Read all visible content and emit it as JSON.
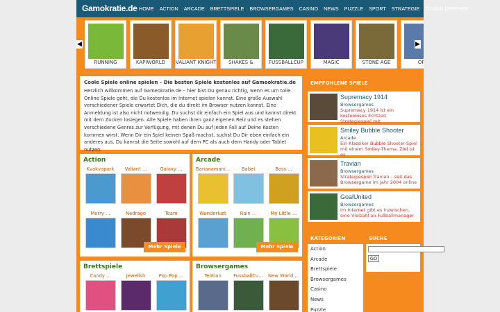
{
  "header": {
    "logo": "Gamokratie.de",
    "nav": [
      "HOME",
      "ACTION",
      "ARCADE",
      "BRETTSPIELE",
      "BROWSERGAMES",
      "CASINO",
      "NEWS",
      "PUZZLE",
      "SPORT",
      "STRATEGIE",
      "TOWER DEFENSE"
    ]
  },
  "slider": {
    "items": [
      {
        "label": "RUNNING",
        "color": "#7ab83a"
      },
      {
        "label": "KAPIWORLD",
        "color": "#8a5a2a"
      },
      {
        "label": "VALIANT KNIGHT",
        "color": "#e8a030"
      },
      {
        "label": "SHAKES &",
        "color": "#6a8a4a"
      },
      {
        "label": "FUSSBALLCUP",
        "color": "#3a6a3a"
      },
      {
        "label": "MAGIC",
        "color": "#4a3a7a"
      },
      {
        "label": "STONE AGE",
        "color": "#7a6a3a"
      },
      {
        "label": "OR",
        "color": "#5a7aaa"
      }
    ]
  },
  "intro": {
    "title": "Coole Spiele online spielen – Die besten Spiele kostenlos auf Gameokratie.de",
    "text": "Herzlich willkommen auf Gameokratie.de – hier bist Du genau richtig, wenn es um tolle Online Spiele geht, die Du kostenlos im Internet spielen kannst. Eine große Auswahl verschiedener Spiele erwartet Dich, die du direkt im Browser nutzen kannst. Eine Anmeldung ist also nicht notwendig. Du suchst dir einfach ein Spiel aus und kannst direkt mit dem Zocken loslegen. Alle Spiele haben ihren ganz eigenen Reiz und es stehen verschiedene Genres zur Verfügung, mit denen Du auf jeden Fall auf Deine Kosten kommen wirst. Wenn Dir ein Spiel keinen Spaß machst, suchst Du Dir eben einfach ein anderes aus. Du kannst die Seite sowohl auf dem PC als auch dem Handy oder Tablet nutzen."
  },
  "sections": [
    {
      "title": "Action",
      "more": "Mehr Spiele",
      "games": [
        {
          "label": "Kvakvapark",
          "color": "#4a9ad0"
        },
        {
          "label": "Valiant ...",
          "color": "#e89040"
        },
        {
          "label": "Galaxy ...",
          "color": "#c04040"
        },
        {
          "label": "Merry ...",
          "color": "#3a8ad0"
        },
        {
          "label": "Nedrago",
          "color": "#7a4a2a"
        },
        {
          "label": "Team",
          "color": "#aa3a3a"
        }
      ]
    },
    {
      "title": "Arcade",
      "more": "Mehr Spiele",
      "games": [
        {
          "label": "Bananamani...",
          "color": "#e8c030"
        },
        {
          "label": "Babel",
          "color": "#80c0e0"
        },
        {
          "label": "Boss ...",
          "color": "#d0a020"
        },
        {
          "label": "Wanderlust",
          "color": "#5aa0d0"
        },
        {
          "label": "Rain ...",
          "color": "#70b050"
        },
        {
          "label": "My Little ...",
          "color": "#8ac040"
        }
      ]
    },
    {
      "title": "Brettspiele",
      "games": [
        {
          "label": "Candy ...",
          "color": "#e05080"
        },
        {
          "label": "Jewelish",
          "color": "#5a2a6a"
        },
        {
          "label": "Pop Pop ...",
          "color": "#40a0d0"
        }
      ]
    },
    {
      "title": "Browsergames",
      "games": [
        {
          "label": "Tentlan",
          "color": "#5a6a8a"
        },
        {
          "label": "FussballCu...",
          "color": "#3a5a3a"
        },
        {
          "label": "New World ...",
          "color": "#6a4a2a"
        }
      ]
    }
  ],
  "featured": {
    "title": "EMPFOHLENE SPIELE",
    "items": [
      {
        "name": "Supremacy 1914",
        "category": "Browsergames",
        "desc": "Supremacy 1914 ist ein kostenloses Echtzeit Strategiespiel mit",
        "color": "#5a4a3a"
      },
      {
        "name": "Smiley Bubble Shooter",
        "category": "Arcade",
        "desc": "Ein Klassiker Bubble Shooter-Spiel mit einem Smiley-Thema, Ziel ist es",
        "color": "#e8c020"
      },
      {
        "name": "Travian",
        "category": "Browsergames",
        "desc": "Strategiespiel Travian – seit das Browsergame im Jahr 2004 online",
        "color": "#8a6a4a"
      },
      {
        "name": "GoalUnited",
        "category": "Browsergames",
        "desc": "Im Internet gibt es inzwischen, eine Vielzahl an Fußballmanager",
        "color": "#3a6a3a"
      }
    ]
  },
  "categories": {
    "title": "KATEGORIEN",
    "items": [
      "Action",
      "Arcade",
      "Brettspiele",
      "Browsergames",
      "Casino",
      "News",
      "Puzzle"
    ]
  },
  "search": {
    "title": "SUCHE",
    "button": "GO"
  }
}
